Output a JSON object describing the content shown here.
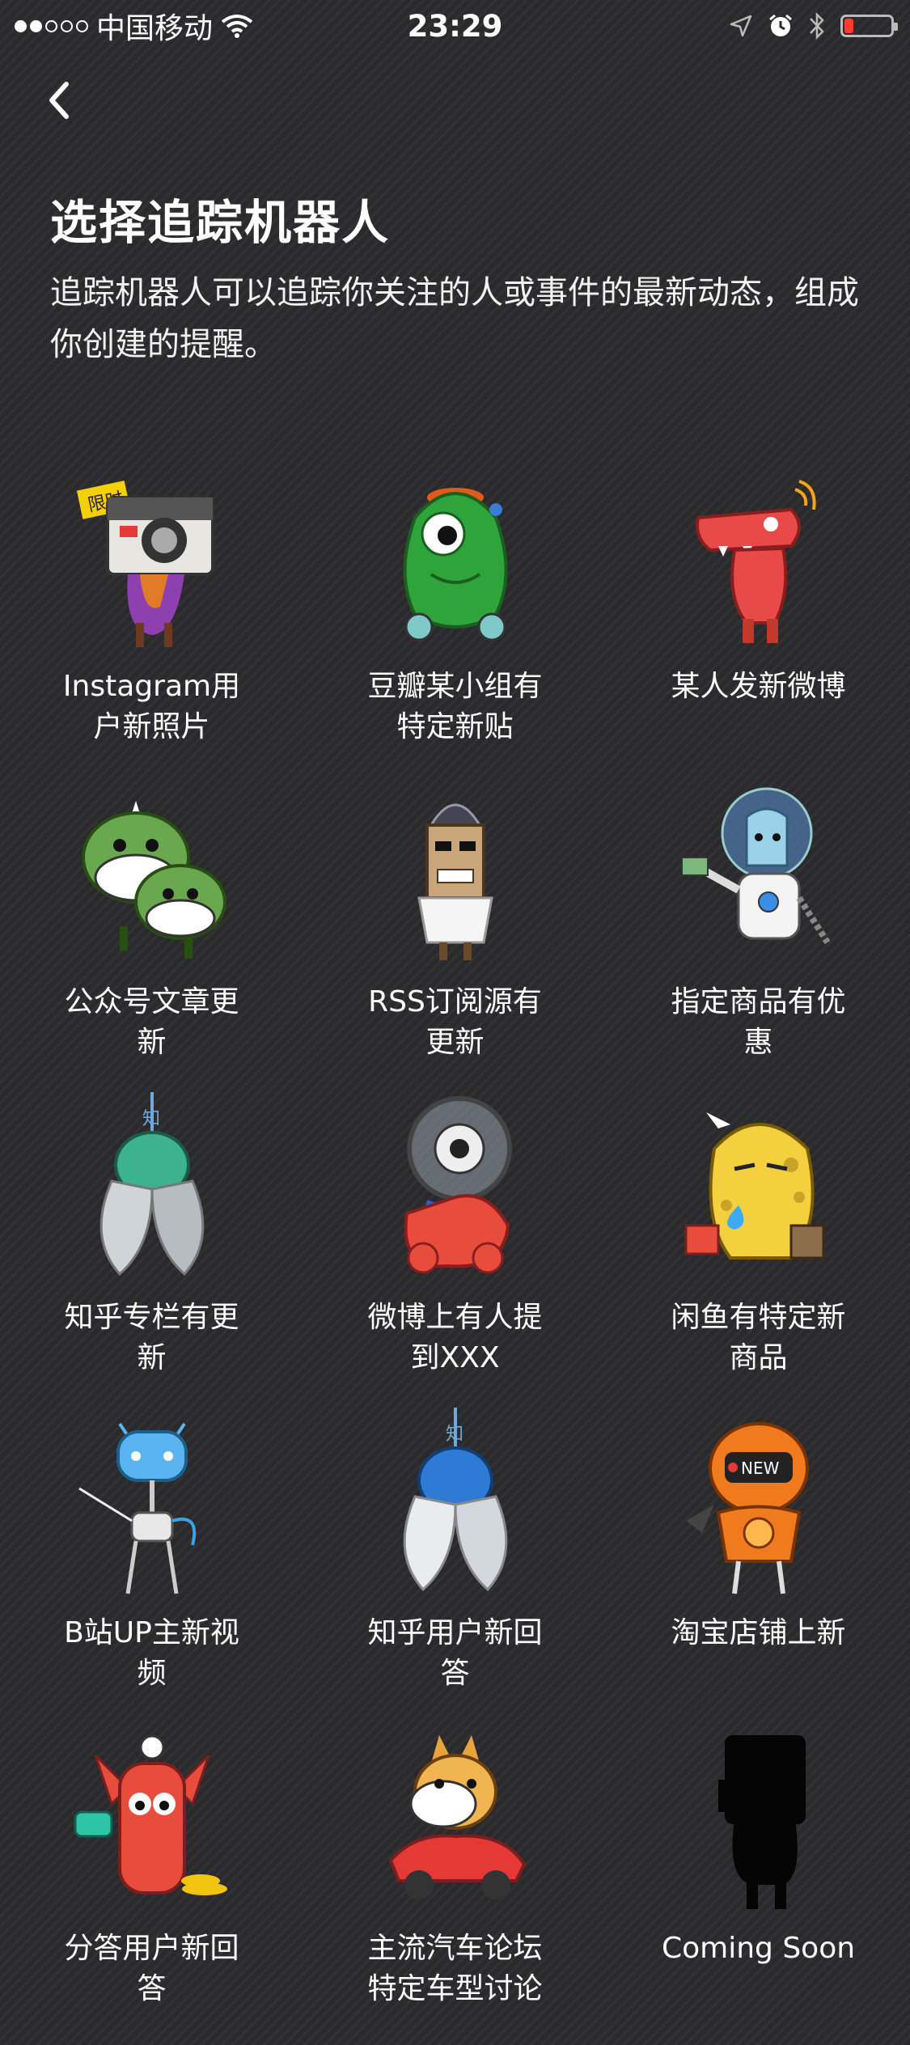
{
  "status_bar": {
    "carrier": "中国移动",
    "time": "23:29"
  },
  "header": {
    "title": "选择追踪机器人",
    "description": "追踪机器人可以追踪你关注的人或事件的最新动态，组成你创建的提醒。"
  },
  "bots": [
    {
      "label": "Instagram用户新照片",
      "badge": "限时"
    },
    {
      "label": "豆瓣某小组有特定新贴"
    },
    {
      "label": "某人发新微博"
    },
    {
      "label": "公众号文章更新"
    },
    {
      "label": "RSS订阅源有更新"
    },
    {
      "label": "指定商品有优惠"
    },
    {
      "label": "知乎专栏有更新"
    },
    {
      "label": "微博上有人提到XXX"
    },
    {
      "label": "闲鱼有特定新商品"
    },
    {
      "label": "B站UP主新视频"
    },
    {
      "label": "知乎用户新回答"
    },
    {
      "label": "淘宝店铺上新",
      "badge": "NEW"
    },
    {
      "label": "分答用户新回答"
    },
    {
      "label": "主流汽车论坛特定车型讨论"
    },
    {
      "label": "Coming Soon"
    }
  ]
}
